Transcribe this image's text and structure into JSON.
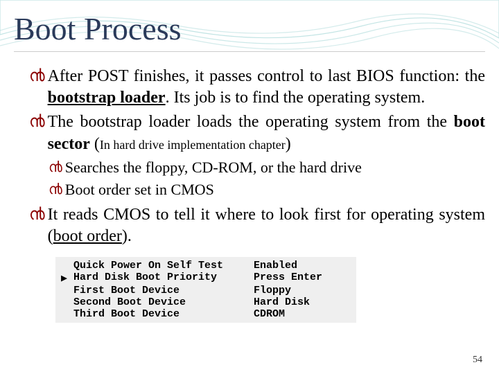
{
  "title": "Boot Process",
  "bullets": {
    "b1_a": "After POST finishes, it passes control to last BIOS function: the ",
    "b1_b": "bootstrap loader",
    "b1_c": ". Its job is to find the operating system.",
    "b2_a": "The bootstrap loader loads the operating system from the ",
    "b2_b": "boot sector",
    "b2_c": " (",
    "b2_d": "In hard drive implementation chapter",
    "b2_e": ")",
    "b3": "Searches the floppy, CD-ROM, or the hard drive",
    "b4": "Boot order set in CMOS",
    "b5_a": "It reads CMOS to tell it where to look first for operating system (",
    "b5_b": "boot order",
    "b5_c": ")."
  },
  "bios": {
    "rows": [
      {
        "arrow": "",
        "label": "Quick Power On Self Test",
        "value": "Enabled"
      },
      {
        "arrow": "▶",
        "label": "Hard Disk Boot Priority",
        "value": "Press Enter"
      },
      {
        "arrow": "",
        "label": "First Boot Device",
        "value": "Floppy"
      },
      {
        "arrow": "",
        "label": "Second Boot Device",
        "value": "Hard Disk"
      },
      {
        "arrow": "",
        "label": "Third Boot Device",
        "value": "CDROM"
      }
    ]
  },
  "page_number": "54",
  "glyph": "൯"
}
